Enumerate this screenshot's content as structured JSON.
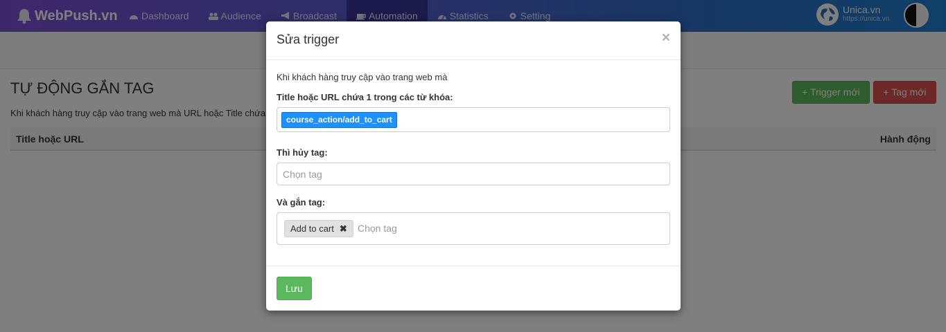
{
  "brand": {
    "name": "WebPush.vn",
    "icon": "bell-icon"
  },
  "nav": {
    "items": [
      {
        "label": "Dashboard",
        "icon": "dashboard-icon"
      },
      {
        "label": "Audience",
        "icon": "users-icon"
      },
      {
        "label": "Broadcast",
        "icon": "bullhorn-icon"
      },
      {
        "label": "Automation",
        "icon": "coffee-icon",
        "active": true
      },
      {
        "label": "Statistics",
        "icon": "gauge-icon"
      },
      {
        "label": "Setting",
        "icon": "gear-icon"
      }
    ]
  },
  "account": {
    "name": "Unica.vn",
    "url": "https://unica.vn"
  },
  "page": {
    "title": "TỰ ĐỘNG GẮN TAG",
    "description": "Khi khách hàng truy cập vào trang web mà URL hoặc Title chứa",
    "new_trigger": "Trigger mới",
    "new_tag": "Tag mới",
    "col_title": "Title hoặc URL",
    "col_action": "Hành động"
  },
  "modal": {
    "title": "Sửa trigger",
    "close": "×",
    "intro": "Khi khách hàng truy cập vào trang web mà",
    "keywords_label": "Title hoặc URL chứa 1 trong các từ khóa:",
    "keyword": "course_action/add_to_cart",
    "remove_label": "Thì hủy tag:",
    "remove_placeholder": "Chọn tag",
    "add_label": "Và gắn tag:",
    "add_tag": "Add to cart",
    "add_tag_remove": "✖",
    "add_placeholder": "Chọn tag",
    "save": "Lưu"
  },
  "colors": {
    "primary_green": "#5cb85c",
    "danger_red": "#d9534f",
    "chip_blue": "#1e90ff"
  }
}
